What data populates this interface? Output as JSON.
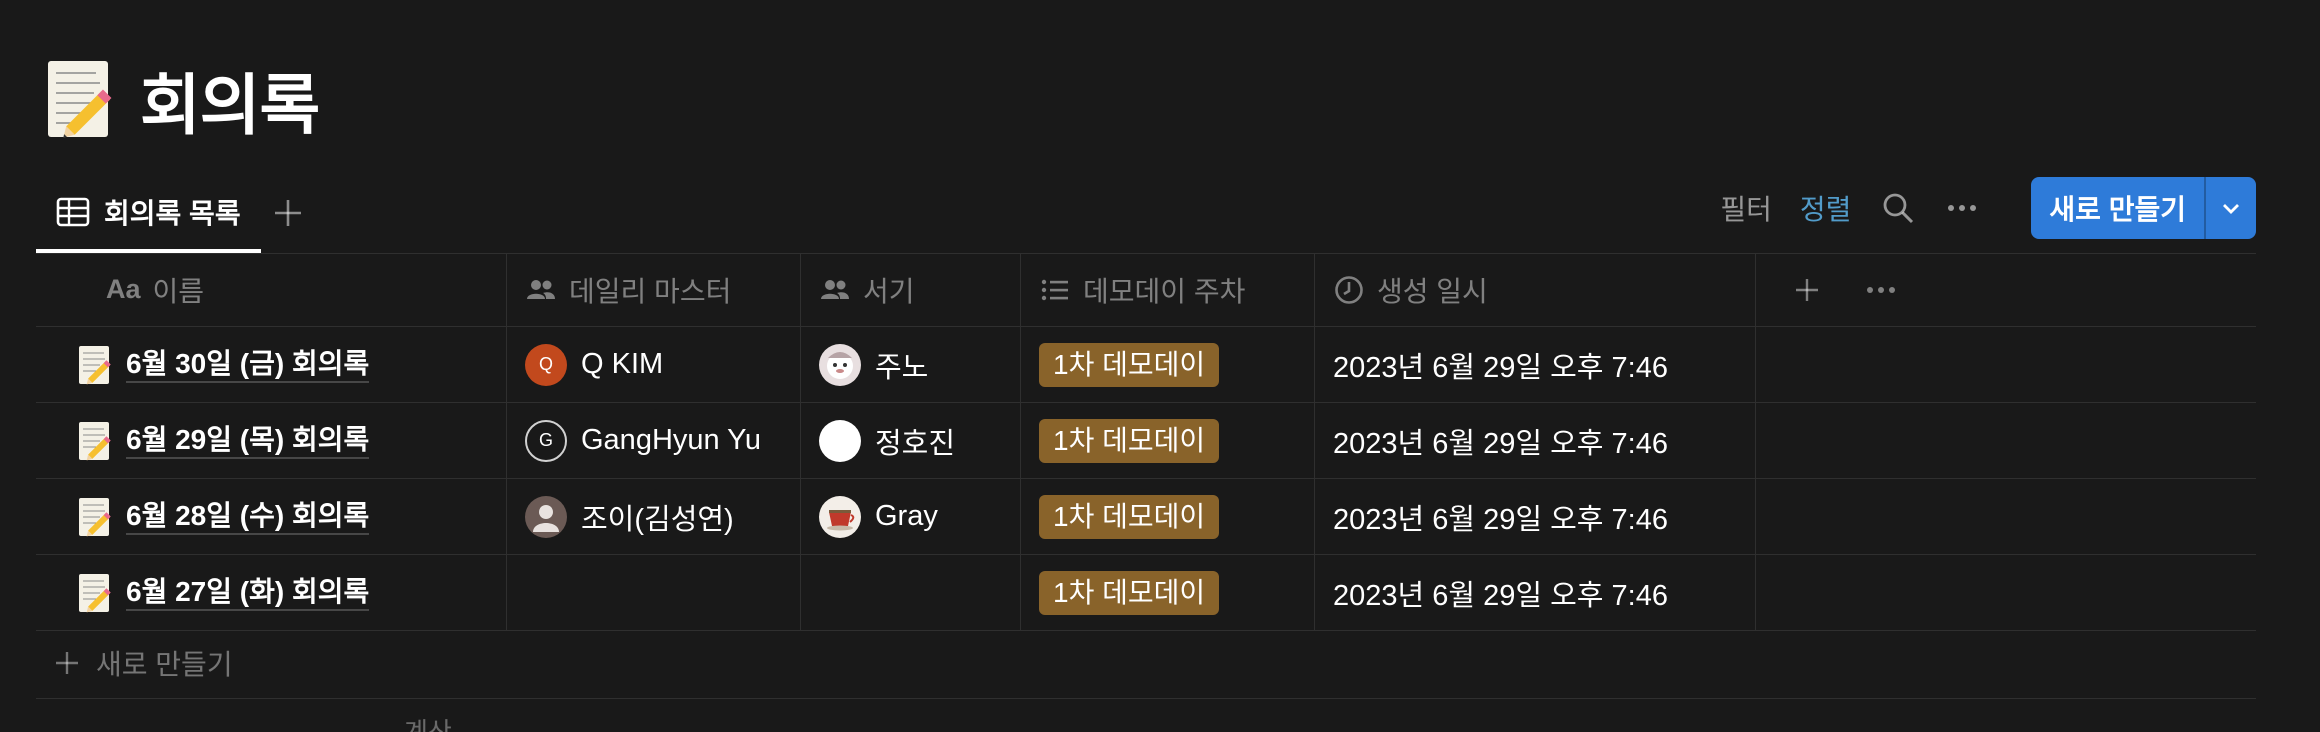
{
  "page": {
    "title": "회의록",
    "icon": "memo-emoji"
  },
  "view": {
    "tab_label": "회의록 목록",
    "tab_icon": "table-icon"
  },
  "toolbar": {
    "filter": "필터",
    "sort": "정렬",
    "new_button": "새로 만들기"
  },
  "columns": [
    {
      "label": "이름",
      "icon": "Aa"
    },
    {
      "label": "데일리 마스터",
      "icon": "people-icon"
    },
    {
      "label": "서기",
      "icon": "people-icon"
    },
    {
      "label": "데모데이 주차",
      "icon": "list-icon"
    },
    {
      "label": "생성 일시",
      "icon": "clock-icon"
    }
  ],
  "rows": [
    {
      "name": "6월 30일 (금) 회의록",
      "master": "Q KIM",
      "master_initial": "Q",
      "writer": "주노",
      "demo": "1차 데모데이",
      "created": "2023년 6월 29일 오후 7:46"
    },
    {
      "name": "6월 29일 (목) 회의록",
      "master": "GangHyun Yu",
      "master_initial": "G",
      "writer": "정호진",
      "demo": "1차 데모데이",
      "created": "2023년 6월 29일 오후 7:46"
    },
    {
      "name": "6월 28일 (수) 회의록",
      "master": "조이(김성연)",
      "master_initial": "",
      "writer": "Gray",
      "demo": "1차 데모데이",
      "created": "2023년 6월 29일 오후 7:46"
    },
    {
      "name": "6월 27일 (화) 회의록",
      "master": "",
      "master_initial": "",
      "writer": "",
      "demo": "1차 데모데이",
      "created": "2023년 6월 29일 오후 7:46"
    }
  ],
  "new_row_label": "새로 만들기",
  "calculate_label": "계산",
  "colors": {
    "background": "#191919",
    "accent_blue": "#2e7bd9",
    "sort_blue": "#529cca",
    "tag_brown": "#89632a"
  }
}
